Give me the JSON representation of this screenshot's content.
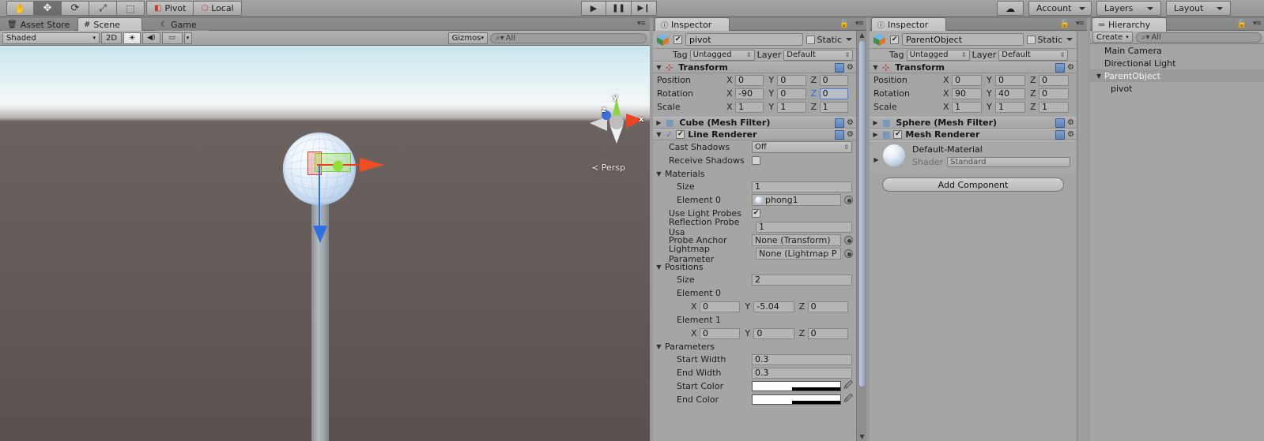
{
  "toolbar": {
    "transform_tools": [
      {
        "name": "hand-tool",
        "glyph": "✋",
        "active": false
      },
      {
        "name": "move-tool",
        "glyph": "✥",
        "active": true
      },
      {
        "name": "rotate-tool",
        "glyph": "⟳",
        "active": false
      },
      {
        "name": "scale-tool",
        "glyph": "⤢",
        "active": false
      },
      {
        "name": "rect-tool",
        "glyph": "⬚",
        "active": false
      }
    ],
    "pivot_label": "Pivot",
    "local_label": "Local",
    "play_label": "▶",
    "pause_label": "❚❚",
    "step_label": "▶❙",
    "cloud_label": "☁",
    "account_label": "Account",
    "layers_label": "Layers",
    "layout_label": "Layout"
  },
  "scene": {
    "tabs": [
      {
        "label": "Asset Store",
        "icon": "store-icon",
        "active": false
      },
      {
        "label": "Scene",
        "icon": "grid-icon",
        "active": true
      },
      {
        "label": "Game",
        "icon": "gamepad-icon",
        "active": false
      }
    ],
    "shading_mode": "Shaded",
    "mode_2d": "2D",
    "light_toggle": "☀",
    "audio_toggle": "◀))",
    "effects_toggle": "🖼",
    "gizmos_label": "Gizmos",
    "search_placeholder": "All",
    "axis_labels": {
      "x": "x",
      "y": "y",
      "z": "z"
    },
    "projection_label": "Persp"
  },
  "inspector_left": {
    "tab_label": "Inspector",
    "object_name": "pivot",
    "object_enabled": true,
    "static_label": "Static",
    "static_checked": false,
    "tag_label": "Tag",
    "tag_value": "Untagged",
    "layer_label": "Layer",
    "layer_value": "Default",
    "transform": {
      "title": "Transform",
      "rows": [
        {
          "label": "Position",
          "x": "0",
          "y": "0",
          "z": "0",
          "z_focus": false
        },
        {
          "label": "Rotation",
          "x": "-90",
          "y": "0",
          "z": "0",
          "z_focus": true
        },
        {
          "label": "Scale",
          "x": "1",
          "y": "1",
          "z": "1",
          "z_focus": false
        }
      ]
    },
    "mesh_filter_title": "Cube (Mesh Filter)",
    "line_renderer": {
      "title": "Line Renderer",
      "enabled": true,
      "cast_shadows_label": "Cast Shadows",
      "cast_shadows_value": "Off",
      "receive_shadows_label": "Receive Shadows",
      "receive_shadows_checked": false,
      "materials_label": "Materials",
      "materials_size_label": "Size",
      "materials_size_value": "1",
      "element0_label": "Element 0",
      "element0_value": "phong1",
      "use_light_probes_label": "Use Light Probes",
      "use_light_probes_checked": true,
      "reflection_probe_label": "Reflection Probe Usa",
      "reflection_probe_value": "1",
      "probe_anchor_label": "Probe Anchor",
      "probe_anchor_value": "None (Transform)",
      "lightmap_param_label": "Lightmap Parameter",
      "lightmap_param_value": "None (Lightmap P",
      "positions_label": "Positions",
      "positions_size_label": "Size",
      "positions_size_value": "2",
      "positions": [
        {
          "label": "Element 0",
          "x": "0",
          "y": "-5.04",
          "z": "0"
        },
        {
          "label": "Element 1",
          "x": "0",
          "y": "0",
          "z": "0"
        }
      ],
      "parameters_label": "Parameters",
      "start_width_label": "Start Width",
      "start_width_value": "0.3",
      "end_width_label": "End Width",
      "end_width_value": "0.3",
      "start_color_label": "Start Color",
      "end_color_label": "End Color"
    }
  },
  "inspector_right": {
    "tab_label": "Inspector",
    "object_name": "ParentObject",
    "object_enabled": true,
    "static_label": "Static",
    "static_checked": false,
    "tag_label": "Tag",
    "tag_value": "Untagged",
    "layer_label": "Layer",
    "layer_value": "Default",
    "transform": {
      "title": "Transform",
      "rows": [
        {
          "label": "Position",
          "x": "0",
          "y": "0",
          "z": "0"
        },
        {
          "label": "Rotation",
          "x": "90",
          "y": "40",
          "z": "0"
        },
        {
          "label": "Scale",
          "x": "1",
          "y": "1",
          "z": "1"
        }
      ]
    },
    "mesh_filter_title": "Sphere (Mesh Filter)",
    "mesh_renderer_title": "Mesh Renderer",
    "mesh_renderer_enabled": true,
    "material_name": "Default-Material",
    "shader_label": "Shader",
    "shader_value": "Standard",
    "add_component_label": "Add Component"
  },
  "hierarchy": {
    "tab_label": "Hierarchy",
    "create_label": "Create",
    "search_placeholder": "All",
    "items": [
      {
        "label": "Main Camera",
        "depth": 0,
        "selected": false,
        "expandable": false
      },
      {
        "label": "Directional Light",
        "depth": 0,
        "selected": false,
        "expandable": false
      },
      {
        "label": "ParentObject",
        "depth": 0,
        "selected": true,
        "expandable": true
      },
      {
        "label": "pivot",
        "depth": 1,
        "selected": false,
        "expandable": false
      }
    ]
  },
  "colors": {
    "accent_red": "#f10000",
    "focus_blue": "#4b7fd6",
    "panel_bg": "#a5a5a5",
    "toolbar_bg": "#9a9a9a"
  }
}
